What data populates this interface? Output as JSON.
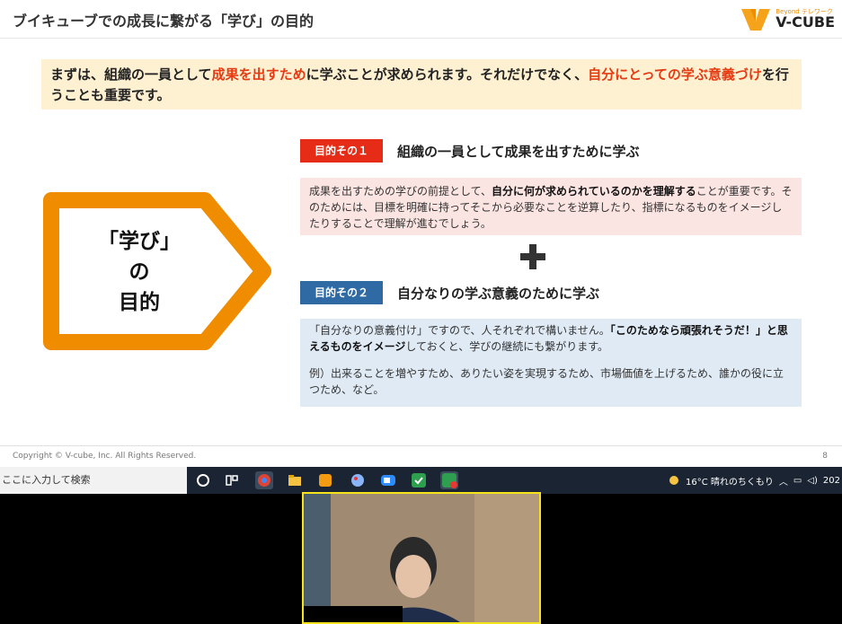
{
  "slide": {
    "title": "ブイキューブでの成長に繋がる「学び」の目的",
    "logo": {
      "tagline": "Beyond テレワーク",
      "brand": "V-CUBE"
    },
    "intro": {
      "part1": "まずは、組織の一員として",
      "highlight1": "成果を出すため",
      "part2": "に学ぶことが求められます。それだけでなく、",
      "highlight2": "自分にとっての学ぶ意義づけ",
      "part3": "を行うことも重要です。"
    },
    "arrow": {
      "line1": "「学び」",
      "line2": "の",
      "line3": "目的"
    },
    "purpose1": {
      "badge": "目的その１",
      "heading": "組織の一員として成果を出すために学ぶ",
      "text1": "成果を出すための学びの前提として、",
      "bold1": "自分に何が求められているのかを理解する",
      "text2": "ことが重要です。そのためには、目標を明確に持ってそこから必要なことを逆算したり、指標になるものをイメージしたりすることで理解が進むでしょう。"
    },
    "purpose2": {
      "badge": "目的その２",
      "heading": "自分なりの学ぶ意義のために学ぶ",
      "text1": "「自分なりの意義付け」ですので、人それぞれで構いません。",
      "bold1": "「このためなら頑張れそうだ！」と思えるものをイメージ",
      "text2": "しておくと、学びの継続にも繋がります。",
      "example": "例）出来ることを増やすため、ありたい姿を実現するため、市場価値を上げるため、誰かの役に立つため、など。"
    },
    "footer": {
      "copyright": "Copyright © V-cube, Inc. All Rights Reserved.",
      "page": "8"
    }
  },
  "taskbar": {
    "search_placeholder": "ここに入力して検索",
    "weather": "16°C 晴れのちくもり",
    "clock": "202"
  },
  "colors": {
    "accent_orange": "#f08c00",
    "red": "#e62c16",
    "blue": "#2f6aa5"
  }
}
